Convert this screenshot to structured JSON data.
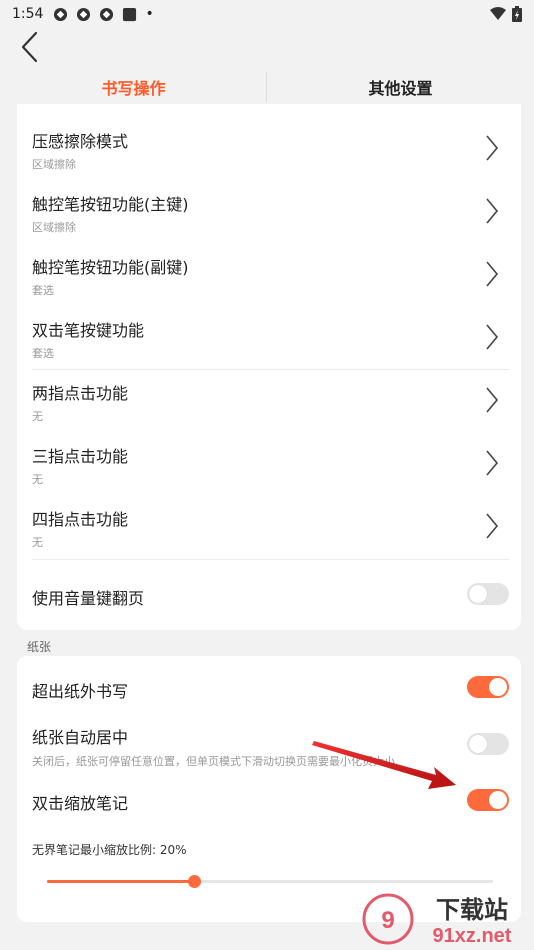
{
  "status": {
    "time": "1:54",
    "dot": "•"
  },
  "tabs": [
    {
      "label": "书写操作",
      "active": true
    },
    {
      "label": "其他设置",
      "active": false
    }
  ],
  "writing": {
    "items": [
      {
        "title": "压感擦除模式",
        "sub": "区域擦除"
      },
      {
        "title": "触控笔按钮功能(主键)",
        "sub": "区域擦除"
      },
      {
        "title": "触控笔按钮功能(副键)",
        "sub": "套选"
      },
      {
        "title": "双击笔按键功能",
        "sub": "套选"
      },
      {
        "title": "两指点击功能",
        "sub": "无"
      },
      {
        "title": "三指点击功能",
        "sub": "无"
      },
      {
        "title": "四指点击功能",
        "sub": "无"
      }
    ],
    "volume_page": {
      "title": "使用音量键翻页",
      "on": false
    }
  },
  "paper": {
    "label": "纸张",
    "write_outside": {
      "title": "超出纸外书写",
      "on": true
    },
    "auto_center": {
      "title": "纸张自动居中",
      "sub": "关闭后，纸张可停留任意位置，但单页模式下滑动切换页需要最小化页大小",
      "on": false
    },
    "double_tap_zoom": {
      "title": "双击缩放笔记",
      "on": true
    },
    "min_zoom": {
      "label": "无界笔记最小缩放比例: 20%",
      "fraction": 0.33
    }
  },
  "watermark": {
    "text1": "下载站",
    "text2": "91xz.net"
  },
  "colors": {
    "accent": "#ff5a2b",
    "toggle_on": "#ff6a3d",
    "annotation_arrow": "#d81e1e"
  }
}
